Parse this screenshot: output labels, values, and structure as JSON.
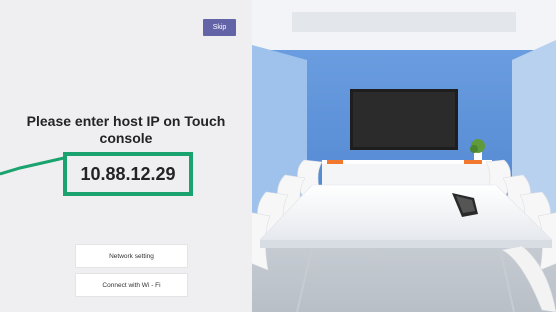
{
  "skip_label": "Skip",
  "prompt": "Please enter host IP on Touch console",
  "host_ip": "10.88.12.29",
  "buttons": {
    "network_setting": "Network setting",
    "connect_wifi": "Connect with Wi - Fi"
  },
  "colors": {
    "accent": "#6264a7",
    "highlight": "#1aa36e",
    "wall": "#5b8fd6"
  },
  "image": {
    "icon": "conference-room-photo"
  }
}
